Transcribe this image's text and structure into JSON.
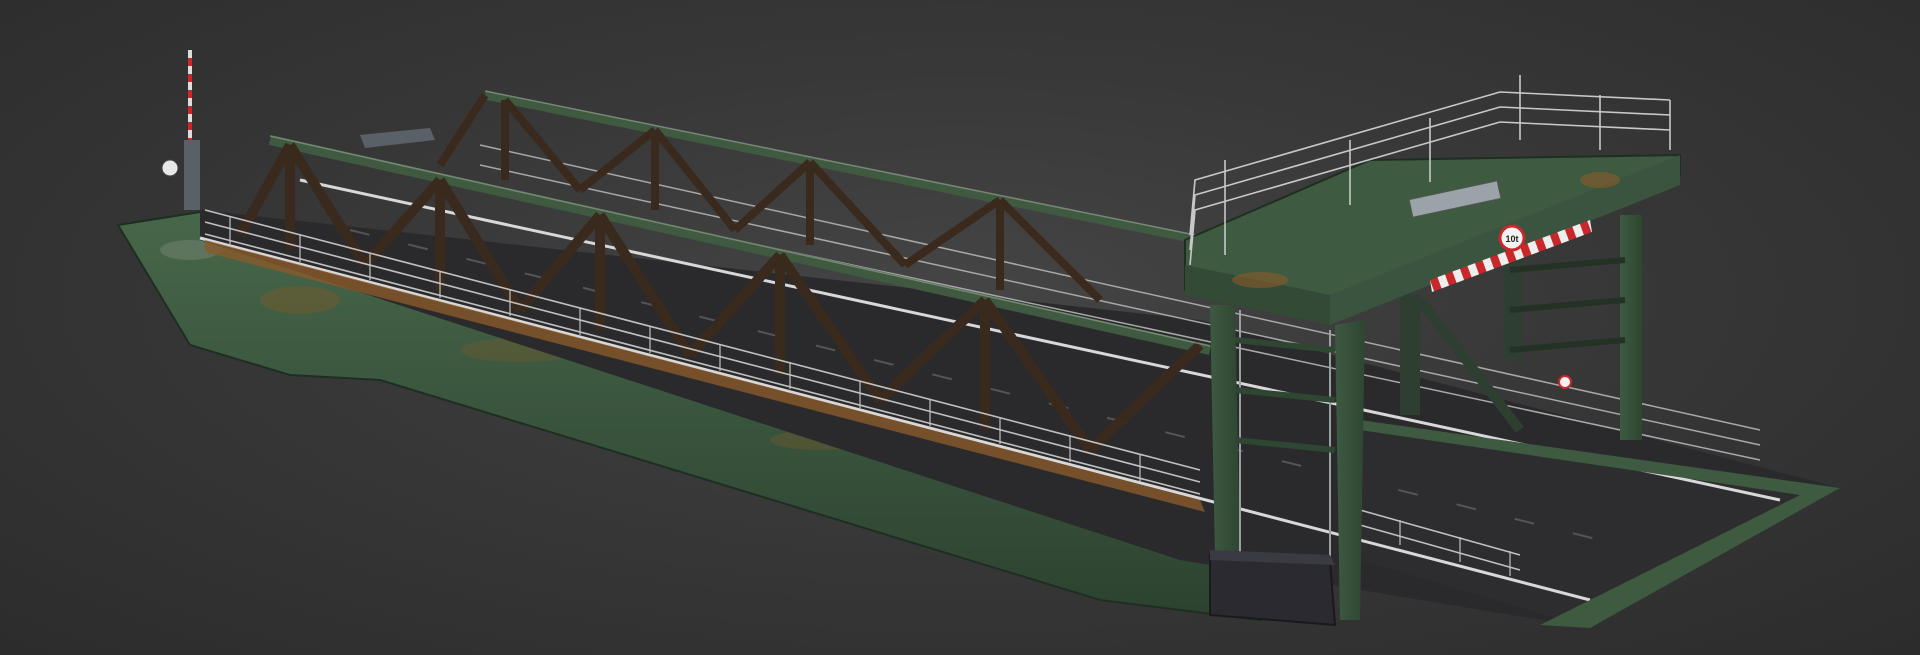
{
  "scene": {
    "subject": "ferry-ramp-bridge",
    "colors": {
      "background": "#3a3a3a",
      "hull_green": "#3e5a40",
      "rust": "#8a5a2a",
      "truss_dark": "#3a2a1e",
      "asphalt": "#2a2a2c",
      "railing": "#b8b8b8",
      "warning_red": "#c8282a"
    },
    "sign_text": "10t"
  }
}
